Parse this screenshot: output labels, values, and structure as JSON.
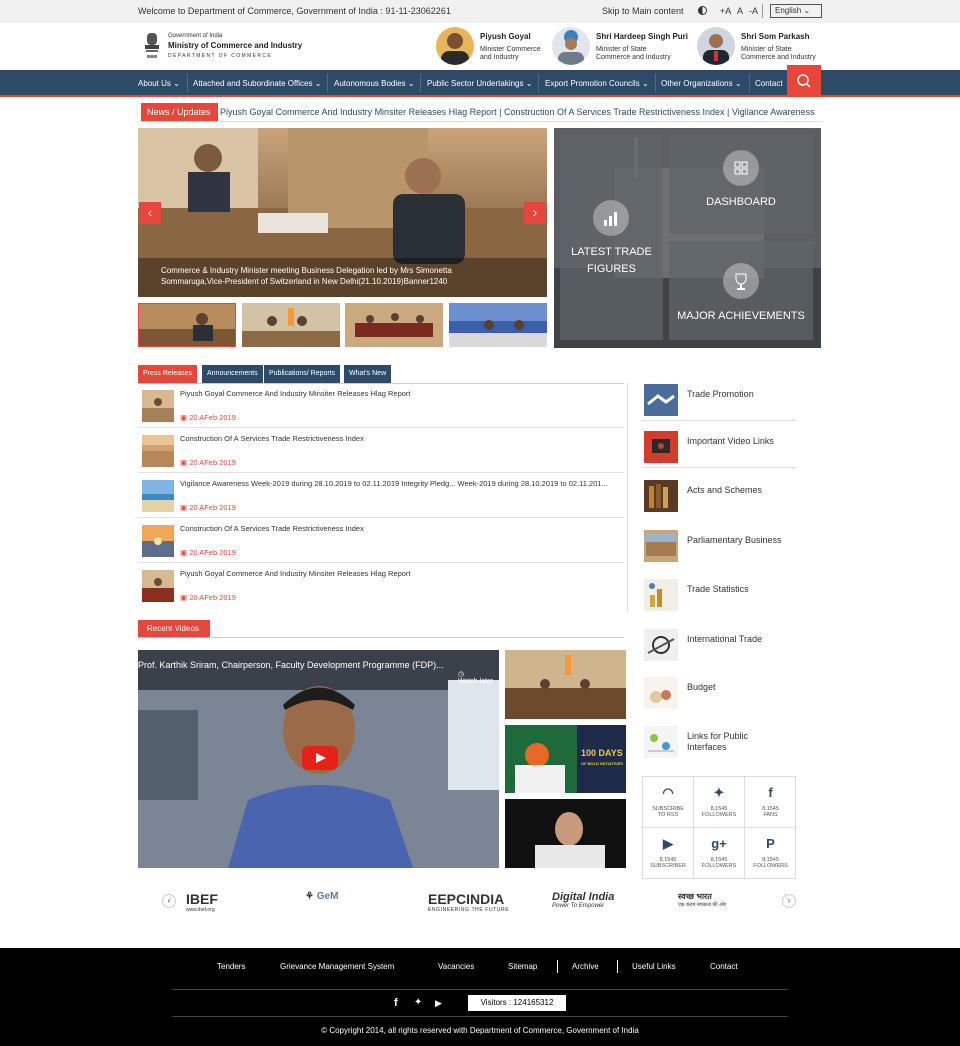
{
  "topbar": {
    "welcome": "Welcome to Department of Commerce, Government of India : 91-11-23062261",
    "skip": "Skip to Main content",
    "font_large": "+A",
    "font_normal": "A",
    "font_small": "-A",
    "language": "English"
  },
  "header": {
    "logo_line1": "Government of India",
    "logo_line2": "Ministry of Commerce and Industry",
    "logo_line3": "DEPARTMENT OF COMMERCE",
    "ministers": [
      {
        "name": "Piyush Goyal",
        "desc": [
          "Minister Commerce",
          "and Industry"
        ]
      },
      {
        "name": "Shri Hardeep Singh Puri",
        "desc": [
          "Minister of State",
          "Commerce and Industry"
        ]
      },
      {
        "name": "Shri Som Parkash",
        "desc": [
          "Minister of State",
          "Commerce and Industry"
        ]
      }
    ]
  },
  "nav": {
    "items": [
      "About Us",
      "Attached and Subordinate Offices",
      "Autonomous Bodies",
      "Public Sector Undertakings",
      "Export Promotion Councils",
      "Other Organizations",
      "Contact"
    ]
  },
  "ticker": {
    "label": "News / Updates",
    "text": "Piyush Goyal Commerce And Industry Minsiter Releases Hlag Report  |  Construction Of A Services Trade Restrictiveness Index  |   Vigilance Awareness"
  },
  "slider": {
    "caption": "Commerce & Industry Minister meeting Business Delegation led by Mrs Simonetta Sommaruga,Vice-President of Switzerland in New Delhi(21.10.2019)Banner1240",
    "prev": "‹",
    "next": "›"
  },
  "tiles": {
    "trade": [
      "LATEST TRADE",
      "FIGURES"
    ],
    "dashboard": "DASHBOARD",
    "achievements": "MAJOR ACHIEVEMENTS"
  },
  "tabs": [
    "Press Releases",
    "Announcements",
    "Publications/ Reports",
    "What's New"
  ],
  "news": [
    {
      "title": "Piyush Goyal Commerce And Industry Minsiter Releases Hlag Report",
      "date": "20 AFeb 2019"
    },
    {
      "title": "Construction Of A Services Trade Restrictiveness Index",
      "date": "20 AFeb 2019"
    },
    {
      "title": "Vigilance Awareness Week-2019 during 28.10.2019 to 02.11.2019 Integrity Pledg... Week-2019 during 28.10.2019 to 02.11.201...",
      "date": "20 AFeb 2019"
    },
    {
      "title": "Construction Of A Services Trade Restrictiveness Index",
      "date": "20 AFeb 2019"
    },
    {
      "title": "Piyush Goyal Commerce And Industry Minsiter Releases Hlag Report",
      "date": "20 AFeb 2019"
    }
  ],
  "right_menu": [
    "Trade Promotion",
    "Important Video Links",
    "Acts and Schemes",
    "Parliamentary Business",
    "Trade Statistics",
    "International Trade",
    "Budget",
    "Links for Public Interfaces"
  ],
  "social": [
    {
      "icon": "rss-icon",
      "glyph": "◠",
      "label": [
        "SUBSCRIBE",
        "TO RSS"
      ]
    },
    {
      "icon": "twitter-icon",
      "glyph": "✦",
      "label": [
        "8,1545",
        "FOLLOWERS"
      ]
    },
    {
      "icon": "facebook-icon",
      "glyph": "f",
      "label": [
        "8,1545",
        "FANS"
      ]
    },
    {
      "icon": "youtube-icon",
      "glyph": "▶",
      "label": [
        "8,1545",
        "SUBSCRIBER"
      ]
    },
    {
      "icon": "googleplus-icon",
      "glyph": "g+",
      "label": [
        "8,1545",
        "FOLLOWERS"
      ]
    },
    {
      "icon": "pinterest-icon",
      "glyph": "P",
      "label": [
        "8,1545",
        "FOLLOWERS"
      ]
    }
  ],
  "videos": {
    "label": "Recent Videos",
    "main_title": "Prof. Karthik Sriram, Chairperson, Faculty Development Programme (FDP)...",
    "watch_later": "Watch later",
    "side_text": [
      "100 DAYS",
      "OF BOLD INITIATIVES"
    ]
  },
  "logos": {
    "ibef": "IBEF",
    "ibef_sub": "www.ibef.org",
    "gem": "GeM",
    "eepc": "EEPCINDIA",
    "eepc_sub": "ENGINEERING THE FUTURE",
    "digital": "Digital India",
    "digital_sub": "Power To Empower",
    "swachh": "स्वच्छ भारत",
    "swachh_sub": "एक कदम स्वच्छता की ओर"
  },
  "footer": {
    "links": [
      "Tenders",
      "Grievance Management System",
      "Vacancies",
      "Sitemap",
      "Archive",
      "Useful Links",
      "Contact"
    ],
    "visitors": "Visitors : 124165312",
    "copyright": "© Copyright 2014, all rights reserved with Department of Commerce, Government of India"
  },
  "colors": {
    "accent": "#e6463b",
    "navy": "#2d4b68",
    "footer": "#000000"
  }
}
